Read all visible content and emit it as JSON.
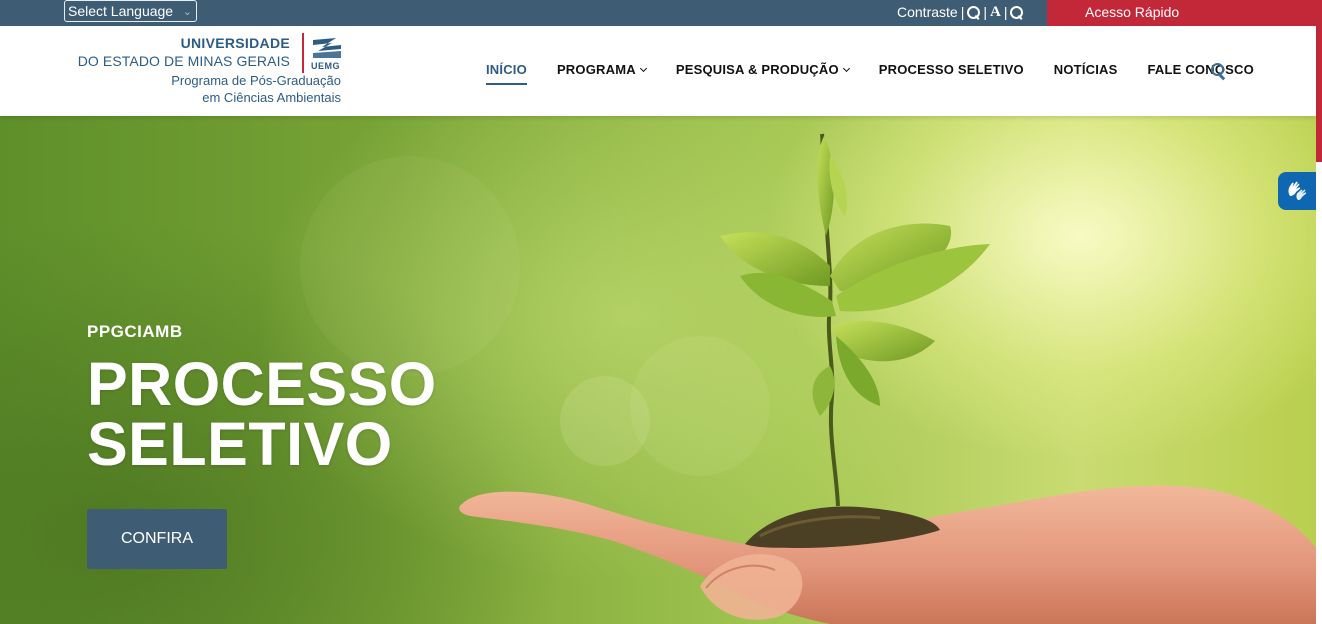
{
  "topbar": {
    "language_select": "Select Language",
    "contrast_label": "Contraste",
    "separator": "|",
    "font_label": "A",
    "quick_access": "Acesso Rápido"
  },
  "header": {
    "logo": {
      "line1": "UNIVERSIDADE",
      "line2": "DO ESTADO DE MINAS GERAIS",
      "acronym": "UEMG",
      "program_line1": "Programa de Pós-Graduação",
      "program_line2": "em Ciências Ambientais"
    },
    "nav": [
      {
        "label": "INÍCIO",
        "active": true
      },
      {
        "label": "PROGRAMA",
        "dropdown": true
      },
      {
        "label": "PESQUISA & PRODUÇÃO",
        "dropdown": true
      },
      {
        "label": "PROCESSO SELETIVO"
      },
      {
        "label": "NOTÍCIAS"
      },
      {
        "label": "FALE CONOSCO"
      }
    ]
  },
  "hero": {
    "kicker": "PPGCIAMB",
    "title_line1": "PROCESSO",
    "title_line2": "SELETIVO",
    "cta": "CONFIRA"
  },
  "icons": {
    "zoom_in": "zoom-in-icon",
    "zoom_out": "zoom-out-icon",
    "search": "search-icon",
    "libras": "sign-language-hands-icon"
  },
  "colors": {
    "topbar_bg": "#3e5c73",
    "accent_red": "#c32838",
    "brand_blue": "#2c5c86",
    "button_bg": "#3e5c73",
    "libras_blue": "#0f67b1"
  }
}
